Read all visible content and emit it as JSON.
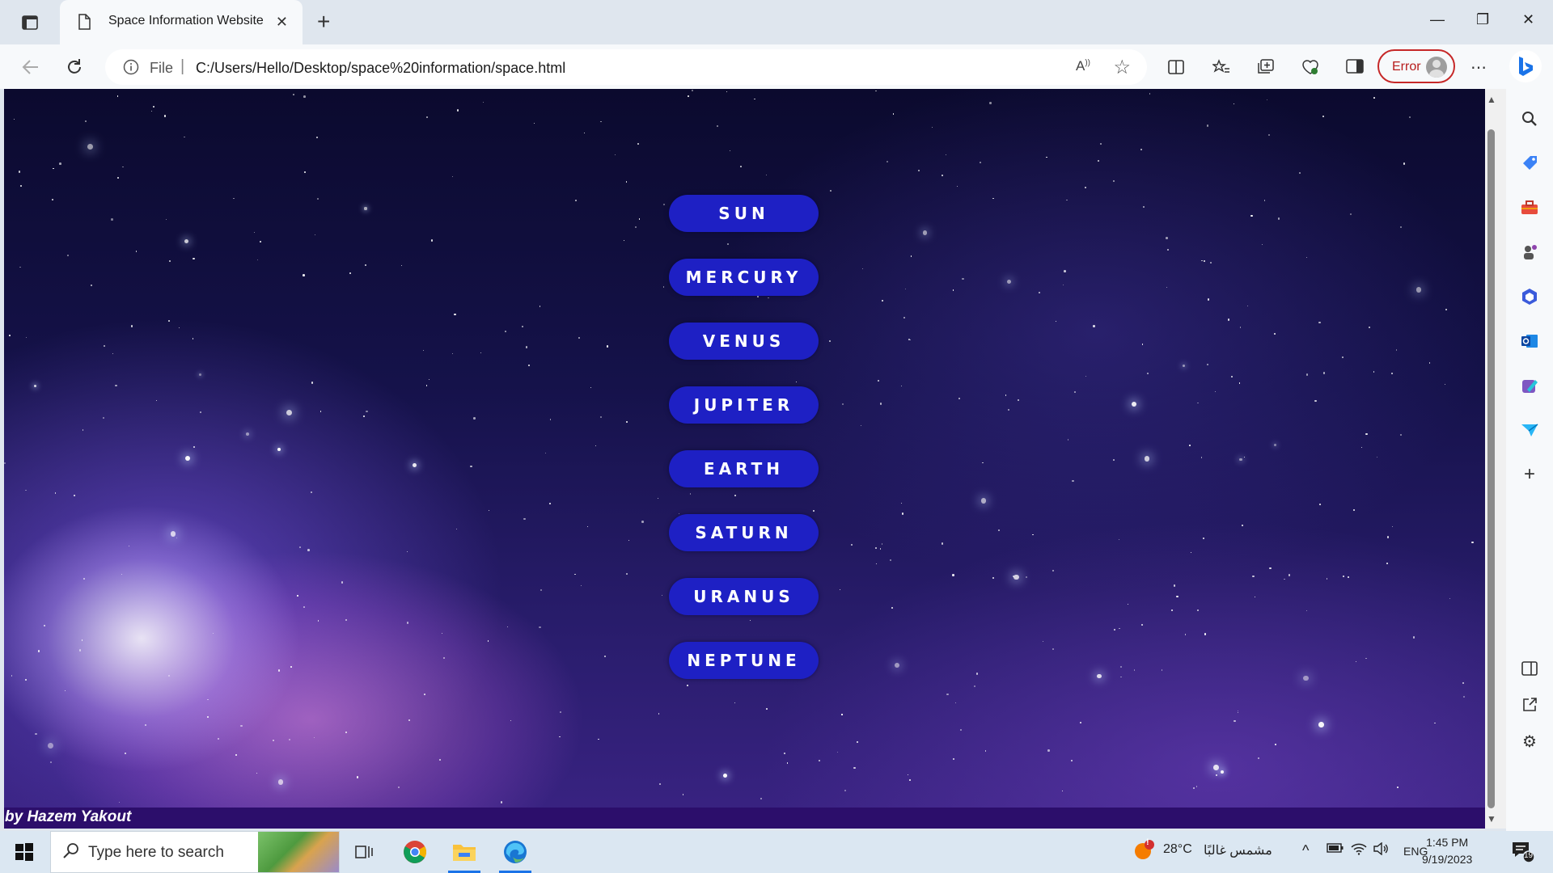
{
  "browser": {
    "tab_title": "Space Information Website",
    "address_prefix": "File",
    "address_separator": "|",
    "url": "C:/Users/Hello/Desktop/space%20information/space.html",
    "error_label": "Error"
  },
  "page": {
    "planets": [
      "SUN",
      "MERCURY",
      "VENUS",
      "JUPITER",
      "EARTH",
      "SATURN",
      "URANUS",
      "NEPTUNE"
    ],
    "footer": "by Hazem Yakout",
    "button_color": "#1e20c4",
    "footer_color": "#2c0e6b"
  },
  "taskbar": {
    "search_placeholder": "Type here to search",
    "weather_temp": "28°C",
    "weather_desc": "مشمس غالبًا",
    "weather_badge": "!",
    "language": "ENG",
    "time": "1:45 PM",
    "date": "9/19/2023",
    "notification_count": "19"
  }
}
